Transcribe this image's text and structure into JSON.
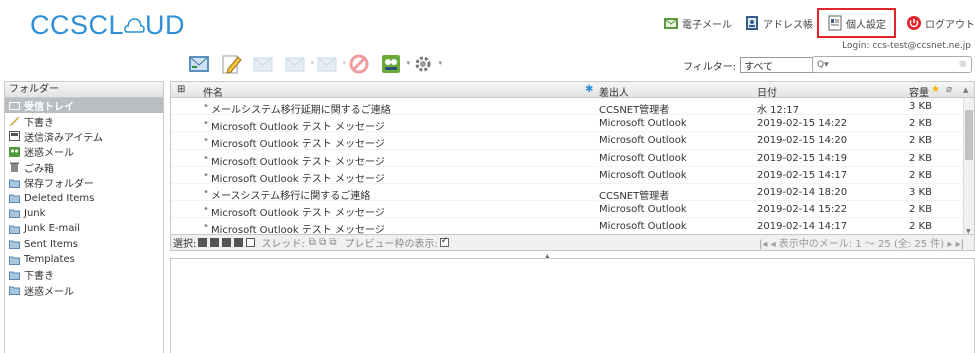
{
  "app": {
    "logo_text": "CCSCL",
    "logo_text_end": "UD"
  },
  "topnav": {
    "mail": "電子メール",
    "addressbook": "アドレス帳",
    "settings": "個人設定",
    "logout": "ログアウト"
  },
  "login_text": "Login: ccs-test@ccsnet.ne.jp",
  "filter": {
    "label": "フィルター:",
    "selected": "すべて"
  },
  "search": {
    "placeholder": "Q▾"
  },
  "folders": {
    "header": "フォルダー",
    "items": [
      {
        "label": "受信トレイ",
        "icon": "inbox-icon",
        "selected": true
      },
      {
        "label": "下書き",
        "icon": "pencil-icon"
      },
      {
        "label": "送信済みアイテム",
        "icon": "sent-icon"
      },
      {
        "label": "迷惑メール",
        "icon": "junk-icon"
      },
      {
        "label": "ごみ箱",
        "icon": "trash-icon"
      },
      {
        "label": "保存フォルダー",
        "icon": "folder-icon"
      },
      {
        "label": "Deleted Items",
        "icon": "folder-icon"
      },
      {
        "label": "Junk",
        "icon": "folder-icon"
      },
      {
        "label": "Junk E-mail",
        "icon": "folder-icon"
      },
      {
        "label": "Sent Items",
        "icon": "folder-icon"
      },
      {
        "label": "Templates",
        "icon": "folder-icon"
      },
      {
        "label": "下書き",
        "icon": "folder-icon"
      },
      {
        "label": "迷惑メール",
        "icon": "folder-icon"
      }
    ]
  },
  "messages": {
    "columns": {
      "subject": "件名",
      "from": "差出人",
      "date": "日付",
      "size": "容量"
    },
    "rows": [
      {
        "subject": "メールシステム移行延期に関するご連絡",
        "from": "CCSNET管理者",
        "date": "水 12:17",
        "size": "3 KB"
      },
      {
        "subject": "Microsoft Outlook テスト メッセージ",
        "from": "Microsoft Outlook",
        "date": "2019-02-15 14:22",
        "size": "2 KB"
      },
      {
        "subject": "Microsoft Outlook テスト メッセージ",
        "from": "Microsoft Outlook",
        "date": "2019-02-15 14:20",
        "size": "2 KB"
      },
      {
        "subject": "Microsoft Outlook テスト メッセージ",
        "from": "Microsoft Outlook",
        "date": "2019-02-15 14:19",
        "size": "2 KB"
      },
      {
        "subject": "Microsoft Outlook テスト メッセージ",
        "from": "Microsoft Outlook",
        "date": "2019-02-15 14:17",
        "size": "2 KB"
      },
      {
        "subject": "メースシステム移行に関するご連絡",
        "from": "CCSNET管理者",
        "date": "2019-02-14 18:20",
        "size": "3 KB"
      },
      {
        "subject": "Microsoft Outlook テスト メッセージ",
        "from": "Microsoft Outlook",
        "date": "2019-02-14 15:22",
        "size": "2 KB"
      },
      {
        "subject": "Microsoft Outlook テスト メッセージ",
        "from": "Microsoft Outlook",
        "date": "2019-02-14 14:17",
        "size": "2 KB"
      }
    ]
  },
  "statusbar": {
    "select_label": "選択:",
    "thread_label": "スレッド:",
    "preview_label": "プレビュー枠の表示:",
    "pager_text": "表示中のメール: 1 〜 25 (全: 25 件)"
  },
  "colors": {
    "brand": "#2f8fd5",
    "highlight": "#e0262b",
    "selected_folder": "#b9bec3"
  }
}
